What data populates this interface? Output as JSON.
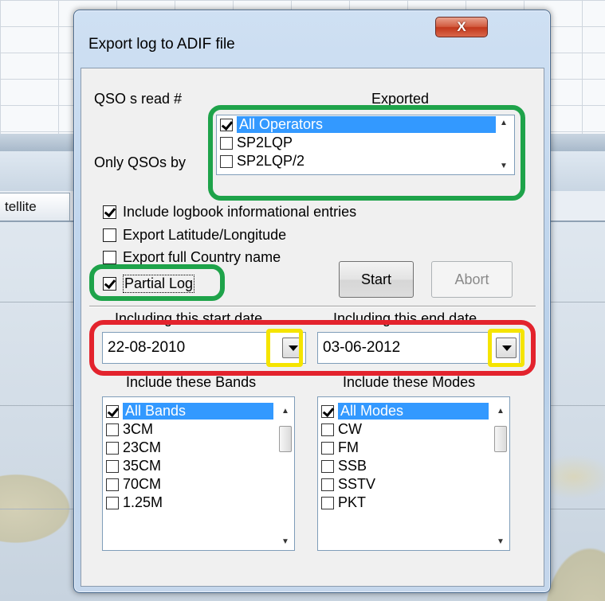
{
  "background": {
    "tab_label": "tellite"
  },
  "dialog": {
    "title": "Export log to ADIF file",
    "close_label": "X",
    "qso_read_label": "QSO s read #",
    "exported_label": "Exported",
    "only_qsos_label": "Only QSOs by",
    "operators": [
      {
        "label": "All Operators",
        "checked": true,
        "selected": true
      },
      {
        "label": "SP2LQP",
        "checked": false,
        "selected": false
      },
      {
        "label": "SP2LQP/2",
        "checked": false,
        "selected": false
      }
    ],
    "options": {
      "include_info": {
        "label": "Include logbook informational entries",
        "checked": true
      },
      "export_latlon": {
        "label": "Export Latitude/Longitude",
        "checked": false
      },
      "export_country": {
        "label": "Export full Country name",
        "checked": false
      },
      "partial_log": {
        "label": "Partial Log",
        "checked": true
      }
    },
    "start_button": "Start",
    "abort_button": "Abort",
    "start_date_label": "Including this start date",
    "end_date_label": "Including this end date",
    "start_date": "22-08-2010",
    "end_date": "03-06-2012",
    "bands_label": "Include these Bands",
    "modes_label": "Include these Modes",
    "bands": [
      {
        "label": "All Bands",
        "checked": true,
        "selected": true
      },
      {
        "label": "3CM",
        "checked": false,
        "selected": false
      },
      {
        "label": "23CM",
        "checked": false,
        "selected": false
      },
      {
        "label": "35CM",
        "checked": false,
        "selected": false
      },
      {
        "label": "70CM",
        "checked": false,
        "selected": false
      },
      {
        "label": "1.25M",
        "checked": false,
        "selected": false
      }
    ],
    "modes": [
      {
        "label": "All Modes",
        "checked": true,
        "selected": true
      },
      {
        "label": "CW",
        "checked": false,
        "selected": false
      },
      {
        "label": "FM",
        "checked": false,
        "selected": false
      },
      {
        "label": "SSB",
        "checked": false,
        "selected": false
      },
      {
        "label": "SSTV",
        "checked": false,
        "selected": false
      },
      {
        "label": "PKT",
        "checked": false,
        "selected": false
      }
    ]
  },
  "colors": {
    "highlight_green": "#1ea34a",
    "highlight_red": "#e3232d",
    "highlight_yellow": "#f5e400",
    "selection_blue": "#3399ff"
  }
}
